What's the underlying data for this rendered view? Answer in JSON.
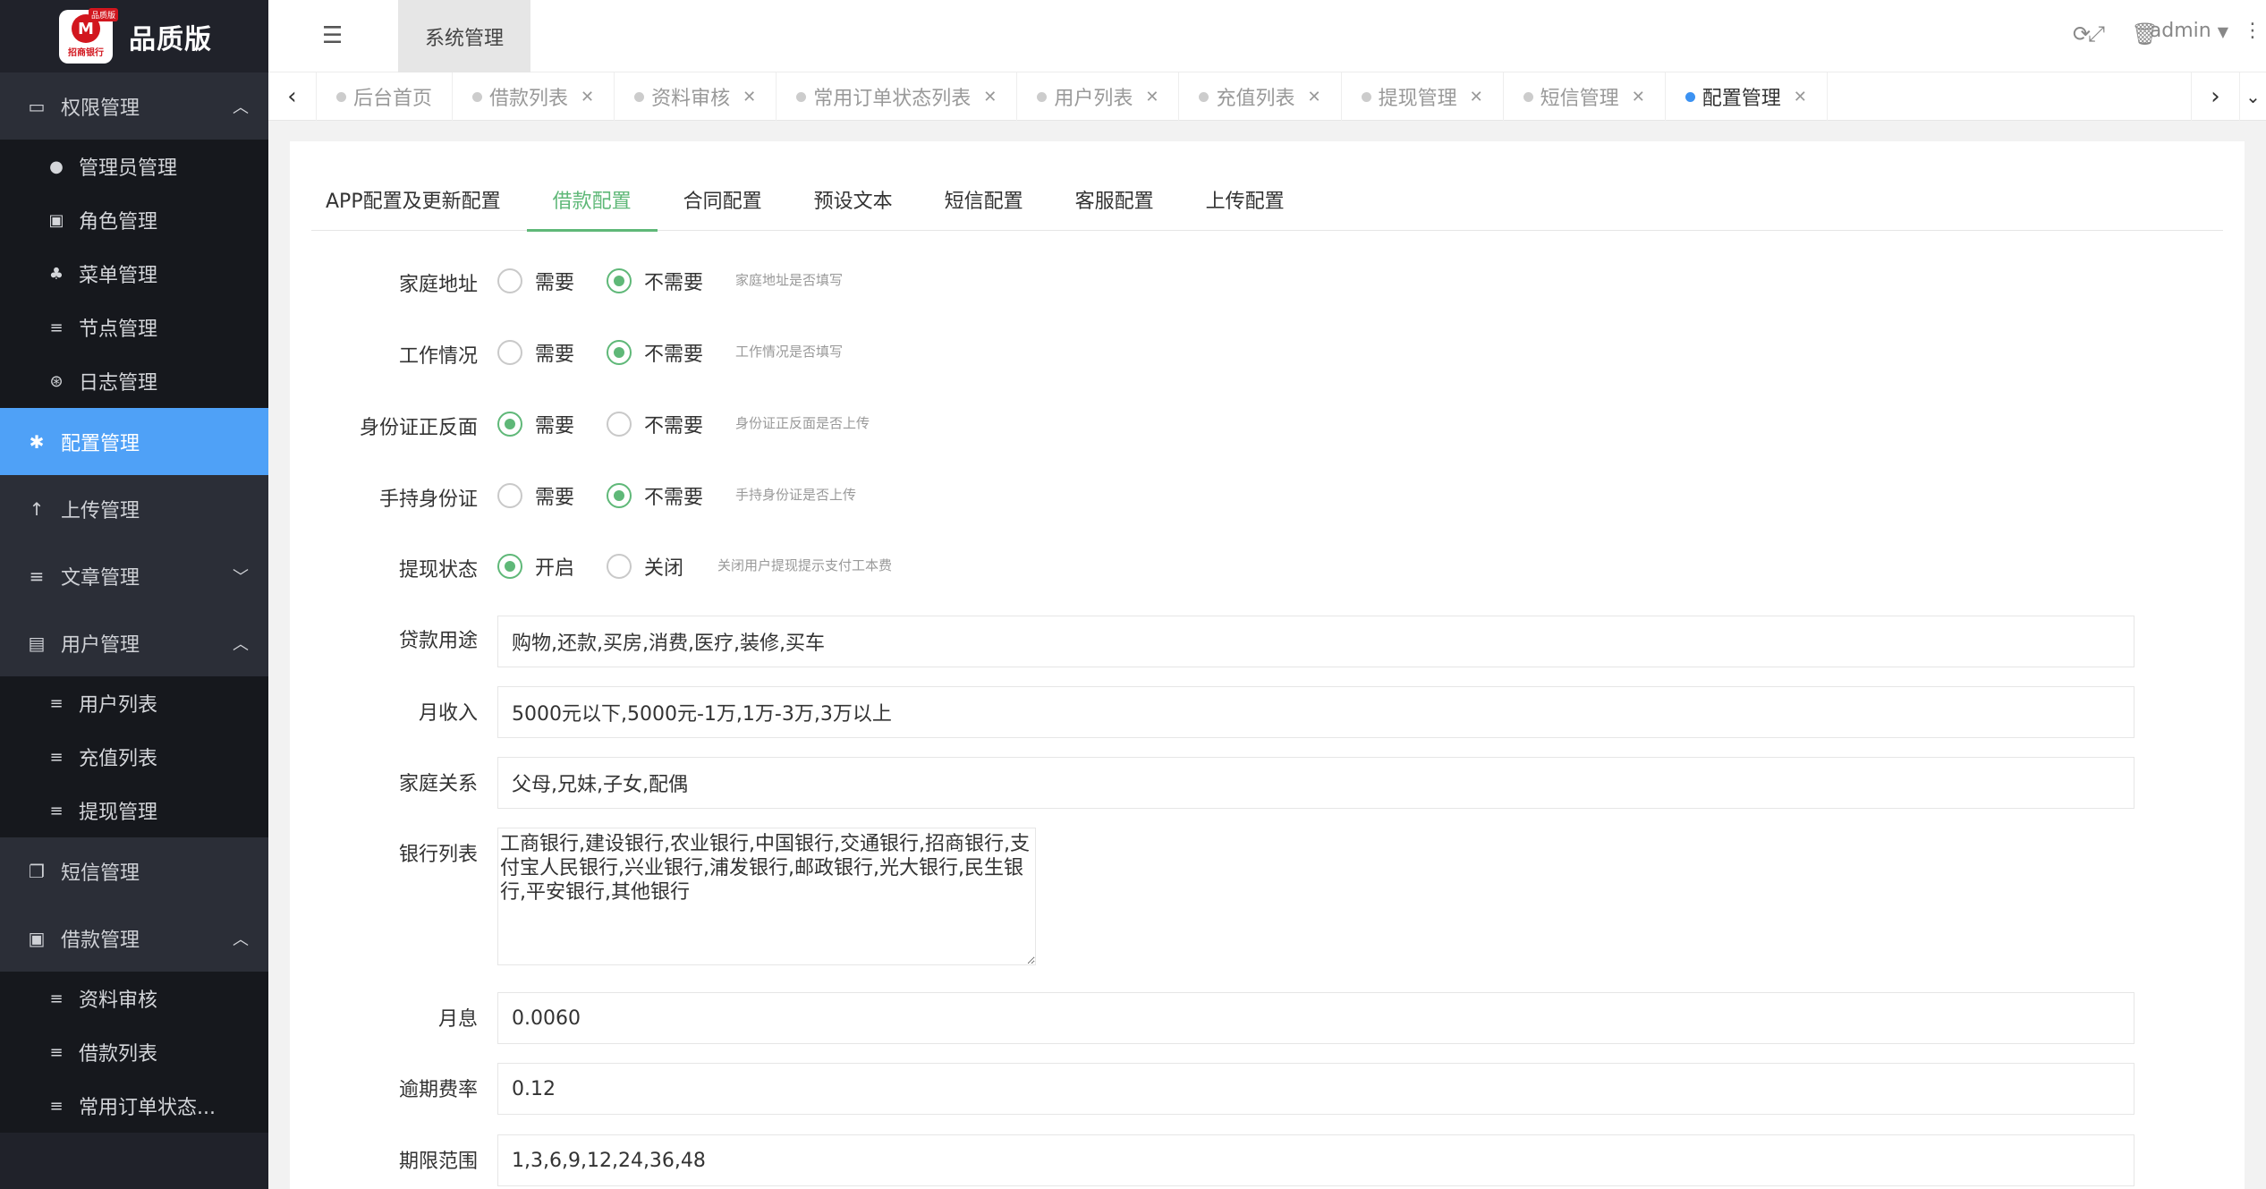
{
  "brand": {
    "title": "品质版",
    "logo_bank": "招商银行",
    "logo_tag": "品质版"
  },
  "sidebar": {
    "groups": [
      {
        "label": "权限管理",
        "icon": "laptop-icon",
        "arrow": "^",
        "items": [
          "管理员管理",
          "角色管理",
          "菜单管理",
          "节点管理",
          "日志管理"
        ]
      },
      {
        "label": "配置管理",
        "icon": "gear-icon",
        "active": true
      },
      {
        "label": "上传管理",
        "icon": "upload-icon"
      },
      {
        "label": "文章管理",
        "icon": "list-icon",
        "arrow": "v"
      },
      {
        "label": "用户管理",
        "icon": "user-card-icon",
        "arrow": "^",
        "items": [
          "用户列表",
          "充值列表",
          "提现管理"
        ]
      },
      {
        "label": "短信管理",
        "icon": "copy-icon"
      },
      {
        "label": "借款管理",
        "icon": "money-icon",
        "arrow": "^",
        "items": [
          "资料审核",
          "借款列表",
          "常用订单状态..."
        ]
      }
    ]
  },
  "header": {
    "system_tab": "系统管理",
    "user": "admin"
  },
  "tabs": [
    {
      "label": "后台首页",
      "closable": false
    },
    {
      "label": "借款列表",
      "closable": true
    },
    {
      "label": "资料审核",
      "closable": true
    },
    {
      "label": "常用订单状态列表",
      "closable": true
    },
    {
      "label": "用户列表",
      "closable": true
    },
    {
      "label": "充值列表",
      "closable": true
    },
    {
      "label": "提现管理",
      "closable": true
    },
    {
      "label": "短信管理",
      "closable": true
    },
    {
      "label": "配置管理",
      "closable": true,
      "active": true
    }
  ],
  "subtabs": [
    "APP配置及更新配置",
    "借款配置",
    "合同配置",
    "预设文本",
    "短信配置",
    "客服配置",
    "上传配置"
  ],
  "form": {
    "home_address": {
      "label": "家庭地址",
      "opt1": "需要",
      "opt2": "不需要",
      "selected": 2,
      "hint": "家庭地址是否填写"
    },
    "work_status": {
      "label": "工作情况",
      "opt1": "需要",
      "opt2": "不需要",
      "selected": 2,
      "hint": "工作情况是否填写"
    },
    "id_card": {
      "label": "身份证正反面",
      "opt1": "需要",
      "opt2": "不需要",
      "selected": 1,
      "hint": "身份证正反面是否上传"
    },
    "hand_id": {
      "label": "手持身份证",
      "opt1": "需要",
      "opt2": "不需要",
      "selected": 2,
      "hint": "手持身份证是否上传"
    },
    "withdraw": {
      "label": "提现状态",
      "opt1": "开启",
      "opt2": "关闭",
      "selected": 1,
      "hint": "关闭用户提现提示支付工本费"
    },
    "loan_use": {
      "label": "贷款用途",
      "value": "购物,还款,买房,消费,医疗,装修,买车"
    },
    "income": {
      "label": "月收入",
      "value": "5000元以下,5000元-1万,1万-3万,3万以上"
    },
    "family": {
      "label": "家庭关系",
      "value": "父母,兄妹,子女,配偶"
    },
    "banks": {
      "label": "银行列表",
      "value": "工商银行,建设银行,农业银行,中国银行,交通银行,招商银行,支付宝人民银行,兴业银行,浦发银行,邮政银行,光大银行,民生银行,平安银行,其他银行"
    },
    "monthly_rate": {
      "label": "月息",
      "value": "0.0060"
    },
    "overdue_rate": {
      "label": "逾期费率",
      "value": "0.12"
    },
    "term_range": {
      "label": "期限范围",
      "value": "1,3,6,9,12,24,36,48"
    }
  },
  "colors": {
    "accent_green": "#5fb878",
    "active_blue": "#4fa1f7",
    "sidebar_bg": "#20222a"
  }
}
